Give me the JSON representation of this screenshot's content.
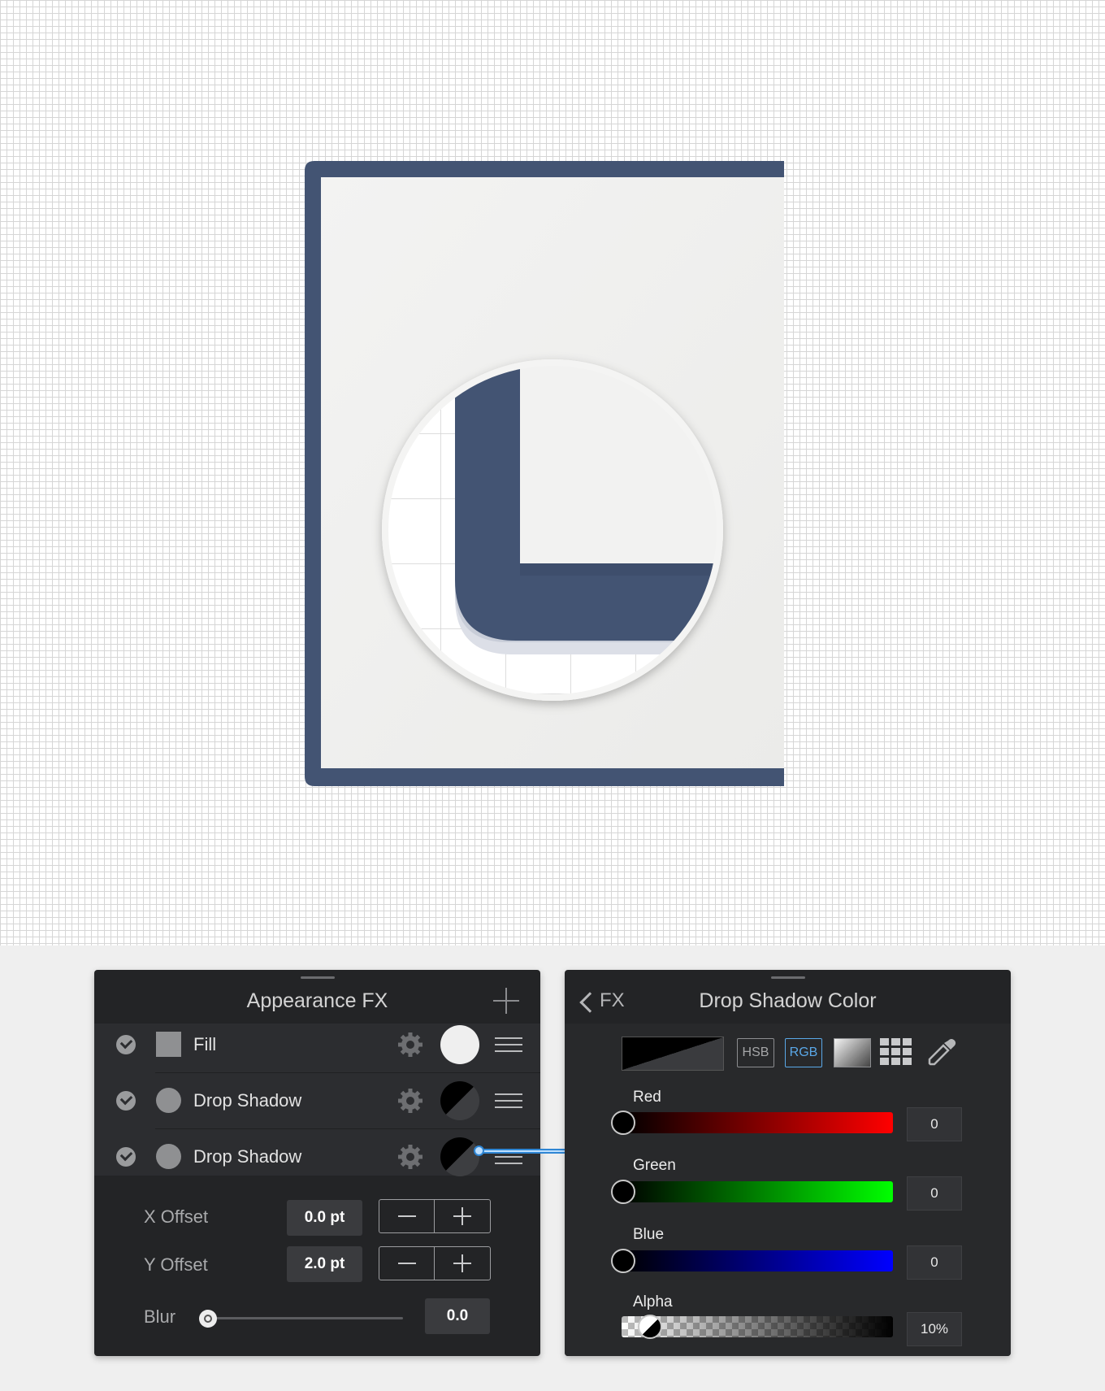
{
  "fx_panel": {
    "title": "Appearance FX",
    "add_icon": "plus-icon",
    "effects": [
      {
        "label": "Fill",
        "enabled": true,
        "swatch": "square",
        "color": "#f2f2f2"
      },
      {
        "label": "Drop Shadow",
        "enabled": true,
        "swatch": "circle",
        "color": "split-black-gray"
      },
      {
        "label": "Drop Shadow",
        "enabled": true,
        "swatch": "circle",
        "color": "split-black-gray"
      }
    ],
    "x_offset": {
      "label": "X Offset",
      "value": "0.0 pt"
    },
    "y_offset": {
      "label": "Y Offset",
      "value": "2.0 pt"
    },
    "blur": {
      "label": "Blur",
      "value": "0.0",
      "level": 0
    }
  },
  "color_panel": {
    "back_label": "FX",
    "title": "Drop Shadow Color",
    "modes": [
      "HSB",
      "RGB"
    ],
    "active_mode": "RGB",
    "channels": [
      {
        "label": "Red",
        "value": "0",
        "color": "#ff0000",
        "level": 0
      },
      {
        "label": "Green",
        "value": "0",
        "color": "#00ff00",
        "level": 0
      },
      {
        "label": "Blue",
        "value": "0",
        "color": "#0000ff",
        "level": 0
      }
    ],
    "alpha": {
      "label": "Alpha",
      "value": "10%",
      "level": 0.1
    }
  },
  "artwork": {
    "frame_color": "#435473",
    "paper_color": "#efefed",
    "grid_color": "#d6d6d6"
  }
}
